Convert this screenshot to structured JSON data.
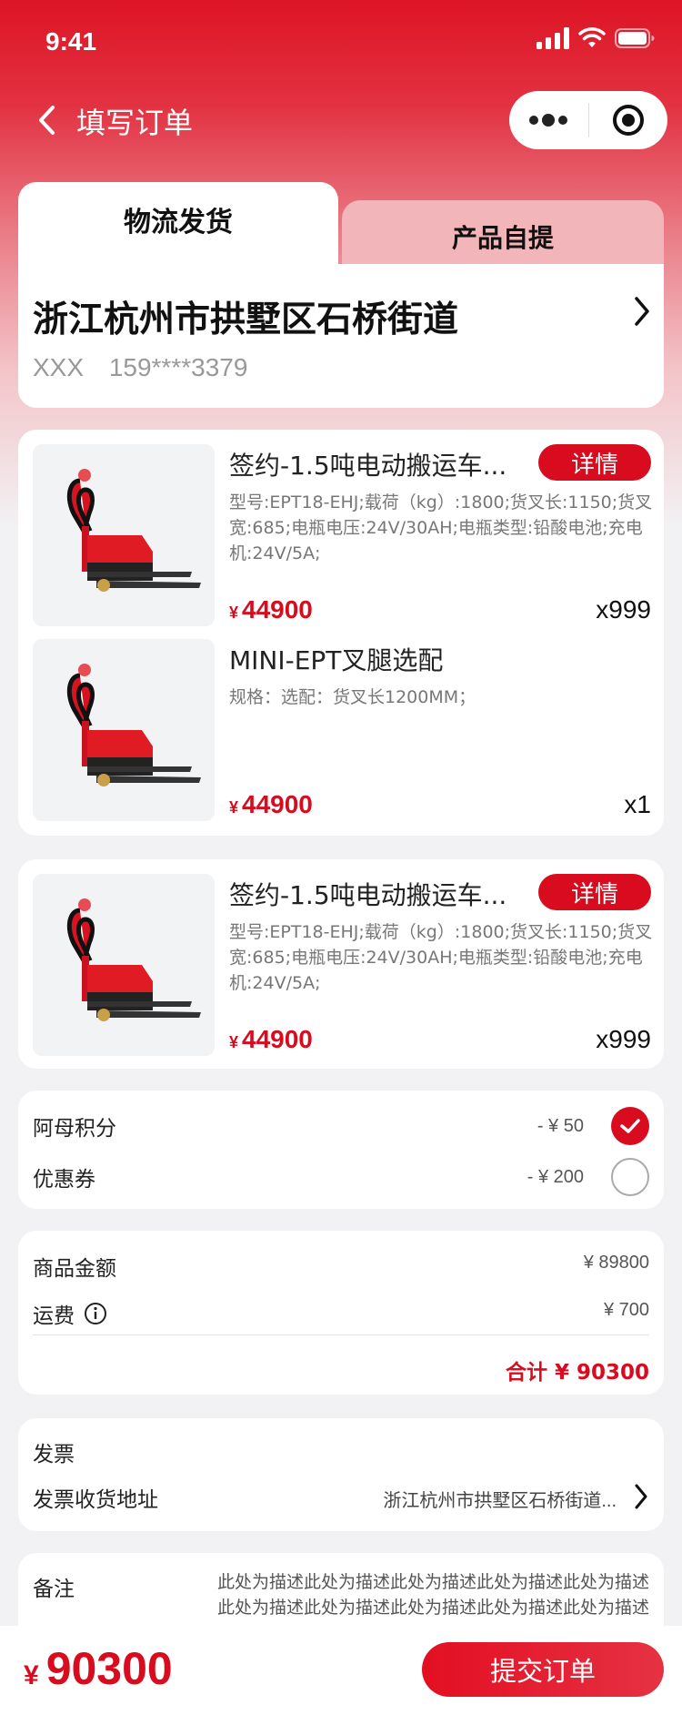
{
  "status_bar": {
    "time": "9:41"
  },
  "nav": {
    "title": "填写订单"
  },
  "tabs": [
    {
      "label": "物流发货",
      "active": true
    },
    {
      "label": "产品自提",
      "active": false
    }
  ],
  "address": {
    "line": "浙江杭州市拱墅区石桥街道",
    "name": "XXX",
    "phone": "159****3379"
  },
  "order_group_1": {
    "main_product": {
      "title": "签约-1.5吨电动搬运车...",
      "detail_label": "详情",
      "spec": "型号:EPT18-EHJ;载荷（kg）:1800;货叉长:1150;货叉宽:685;电瓶电压:24V/30AH;电瓶类型:铅酸电池;充电机:24V/5A;",
      "currency": "¥",
      "price": "44900",
      "qty": "x999"
    },
    "accessory": {
      "title": "MINI-EPT叉腿选配",
      "spec": "规格：选配：货叉长1200MM；",
      "currency": "¥",
      "price": "44900",
      "qty": "x1"
    }
  },
  "order_group_2": {
    "main_product": {
      "title": "签约-1.5吨电动搬运车...",
      "detail_label": "详情",
      "spec": "型号:EPT18-EHJ;载荷（kg）:1800;货叉长:1150;货叉宽:685;电瓶电压:24V/30AH;电瓶类型:铅酸电池;充电机:24V/5A;",
      "currency": "¥",
      "price": "44900",
      "qty": "x999"
    }
  },
  "discounts": {
    "points": {
      "label": "阿母积分",
      "value": "- ¥ 50",
      "checked": true
    },
    "coupon": {
      "label": "优惠券",
      "value": "- ¥ 200",
      "checked": false
    }
  },
  "summary": {
    "goods_label": "商品金额",
    "goods_value": "¥ 89800",
    "shipping_label": "运费",
    "shipping_value": "¥ 700",
    "total_text": "合计 ¥ 90300"
  },
  "invoice": {
    "label": "发票",
    "address_label": "发票收货地址",
    "address_value": "浙江杭州市拱墅区石桥街道..."
  },
  "remark": {
    "label": "备注",
    "text": "此处为描述此处为描述此处为描述此处为描述此处为描述此处为描述此处为描述此处为描述此处为描述此处为描述"
  },
  "bottom": {
    "currency": "¥",
    "total": "90300",
    "submit_label": "提交订单"
  },
  "colors": {
    "brand_red": "#d80c1e",
    "tab_inactive": "#f2b5ba",
    "page_bg": "#f2f2f4"
  }
}
